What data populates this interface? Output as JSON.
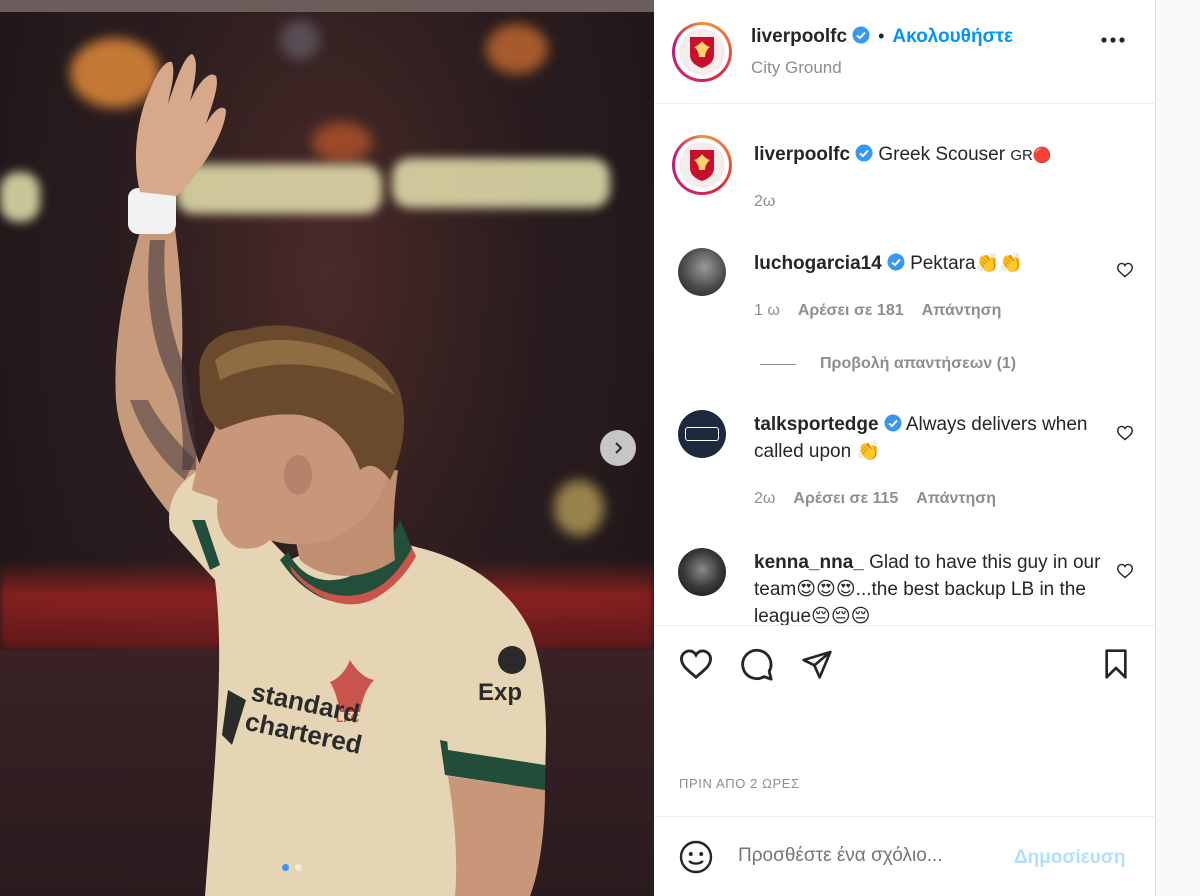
{
  "post": {
    "username": "liverpoolfc",
    "follow_label": "Ακολουθήστε",
    "location": "City Ground",
    "caption": "Greek Scouser",
    "caption_flag": "GR🔴",
    "caption_time": "2ω",
    "time_ago": "ΠΡΙΝ ΑΠΟ 2 ΩΡΕΣ"
  },
  "comments": [
    {
      "username": "luchogarcia14",
      "verified": true,
      "text": "Pektara👏👏",
      "time": "1 ω",
      "likes": "Αρέσει σε 181",
      "reply": "Απάντηση",
      "view_replies": "Προβολή απαντήσεων (1)"
    },
    {
      "username": "talksportedge",
      "verified": true,
      "text": "Always delivers when called upon 👏",
      "time": "2ω",
      "likes": "Αρέσει σε 115",
      "reply": "Απάντηση"
    },
    {
      "username": "kenna_nna_",
      "verified": false,
      "text": "Glad to have this guy in our team😍😍😍...the best backup LB in the league😔😔😔"
    }
  ],
  "add_comment": {
    "placeholder": "Προσθέστε ένα σχόλιο...",
    "post_label": "Δημοσίευση"
  },
  "photo": {
    "shirt_sponsor": "standard chartered",
    "sleeve_sponsor": "Expedia",
    "current_slide": 1,
    "total_slides": 2
  },
  "colors": {
    "accent": "#0095f6",
    "verified": "#3897f0",
    "muted": "#8e8e8e",
    "post_disabled": "#b2dffc"
  },
  "icons": [
    "verified-badge-icon",
    "more-options-icon",
    "heart-icon",
    "comment-icon",
    "share-icon",
    "bookmark-icon",
    "emoji-icon",
    "chevron-right-icon"
  ]
}
